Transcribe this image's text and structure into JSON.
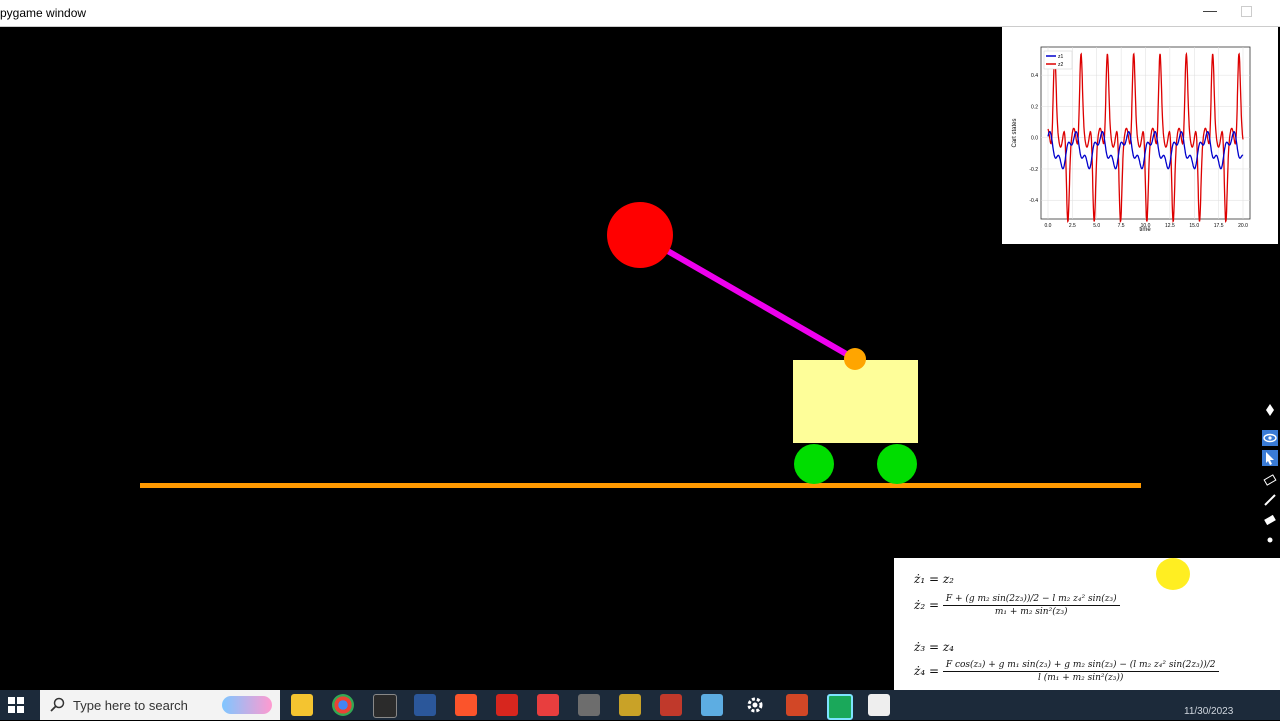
{
  "window": {
    "title": "pygame window"
  },
  "scene": {
    "colors": {
      "background": "#000000",
      "ball": "#ff0000",
      "rod": "#ee00ee",
      "pivot": "#ffa500",
      "cart": "#fefe99",
      "wheels": "#00dd00",
      "track": "#ff9900"
    }
  },
  "plot": {
    "ylabel": "Cart states",
    "xlabel": "time",
    "legend": [
      "z1",
      "z2"
    ],
    "yticks": [
      "0.4",
      "0.2",
      "0.0",
      "-0.2",
      "-0.4"
    ],
    "xticks": [
      "0.0",
      "2.5",
      "5.0",
      "7.5",
      "10.0",
      "12.5",
      "15.0",
      "17.5",
      "20.0"
    ]
  },
  "chart_data": {
    "type": "line",
    "xlabel": "time",
    "ylabel": "Cart states",
    "xlim": [
      0,
      20
    ],
    "ylim": [
      -0.52,
      0.58
    ],
    "grid": true,
    "legend_position": "top-left",
    "series": [
      {
        "name": "z1",
        "color": "#0000cc",
        "amplitude": 0.16,
        "offset": -0.08,
        "period": 2.7
      },
      {
        "name": "z2",
        "color": "#dd0000",
        "peak": 0.52,
        "trough": -0.5,
        "period": 2.7
      }
    ]
  },
  "equations": {
    "eq1_lhs": "ż₁ = z₂",
    "eq2_lhs": "ż₂ =",
    "eq2_num": "F + (g m₂ sin(2z₃))/2 − l m₂ z₄² sin(z₃)",
    "eq2_den": "m₁ + m₂ sin²(z₃)",
    "eq3_lhs": "ż₃ = z₄",
    "eq4_lhs": "ż₄ =",
    "eq4_num": "F cos(z₃) + g m₁ sin(z₃) + g m₂ sin(z₃) − (l m₂ z₄² sin(2z₃))/2",
    "eq4_den": "l (m₁ + m₂ sin²(z₃))"
  },
  "taskbar": {
    "search_placeholder": "Type here to search",
    "clock": "11/30/2023"
  }
}
